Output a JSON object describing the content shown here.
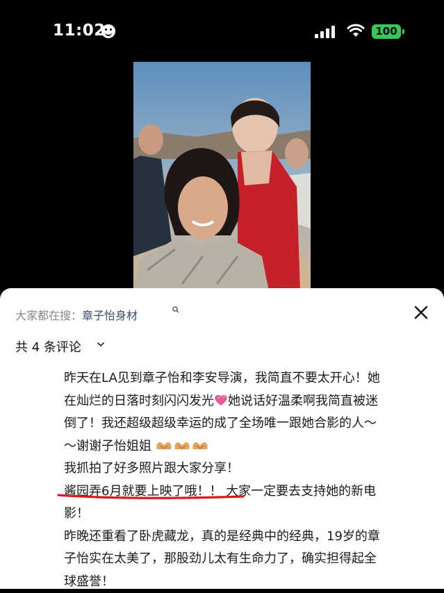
{
  "status_bar": {
    "time": "11:02",
    "battery": "100",
    "icons": [
      "smiley-icon",
      "cellular-signal-icon",
      "wifi-icon",
      "battery-icon"
    ]
  },
  "sheet": {
    "search_prefix": "大家都在搜：",
    "search_term": "章子怡身材",
    "comment_count": "共 4 条评论",
    "icons": [
      "search-icon",
      "close-icon",
      "chevron-down-icon"
    ]
  },
  "comment": {
    "line1": "昨天在LA见到章子怡和李安导演，我简直不要太开心！她",
    "line2a": "在灿烂的日落时刻闪闪发光",
    "line2b": "她说话好温柔啊我简直被迷",
    "line3": "倒了！我还超级超级幸运的成了全场唯一跟她合影的人～",
    "line4": "～谢谢子怡姐姐",
    "line5": "我抓拍了好多照片跟大家分享！",
    "line6a": "酱园弄6月就要上映了哦！！",
    "line6b": "大家一定要去支持她的新电",
    "line7": "影！",
    "line8": "昨晚还重看了卧虎藏龙，真的是经典中的经典，19岁的章",
    "line9": "子怡实在太美了，那股劲儿太有生命力了，确实担得起全",
    "line10": "球盛誉！"
  },
  "colors": {
    "background": "#000000",
    "sheet": "#ffffff",
    "battery": "#36c759",
    "search_term": "#3b4a63",
    "red_underline": "#d9181f"
  }
}
